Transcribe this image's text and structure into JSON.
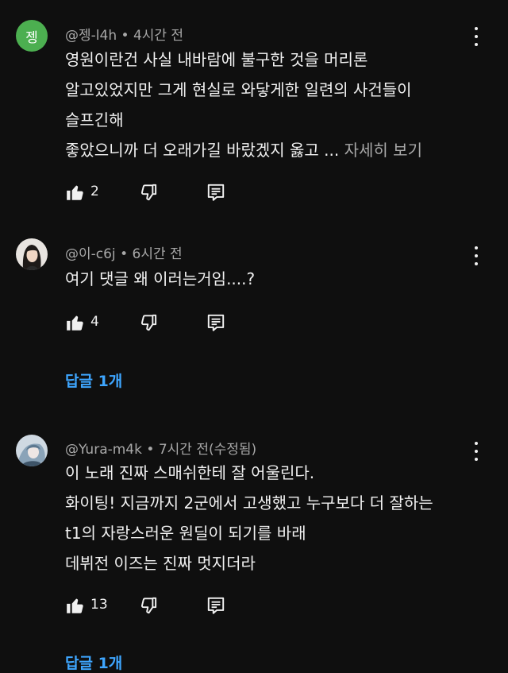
{
  "comments": [
    {
      "avatar_letter": "젱",
      "avatar_color": "#4caf50",
      "handle": "@젱-l4h",
      "time": "4시간 전",
      "lines": [
        "영원이란건 사실 내바람에 불구한 것을 머리론",
        "알고있었지만 그게 현실로 와닿게한 일련의 사건들이",
        "슬프긴해",
        " 좋았으니까 더 오래가길 바랐겠지 옳고 ..."
      ],
      "more_label": "자세히 보기",
      "likes": "2"
    },
    {
      "handle": "@이-c6j",
      "time": "6시간 전",
      "lines": [
        "여기 댓글 왜 이러는거임....?"
      ],
      "likes": "4",
      "replies_label": "답글 1개"
    },
    {
      "handle": "@Yura-m4k",
      "time": "7시간 전(수정됨)",
      "lines": [
        "이 노래 진짜 스매쉬한테 잘 어울린다.",
        "화이팅! 지금까지 2군에서 고생했고 누구보다 더 잘하는",
        "t1의 자랑스러운 원딜이 되기를 바래",
        "데뷔전 이즈는 진짜 멋지더라"
      ],
      "likes": "13",
      "replies_label": "답글 1개"
    }
  ],
  "separator": " • ",
  "colors": {
    "background": "#0f0f0f",
    "text": "#f1f1f1",
    "meta": "#a8a8a8",
    "link": "#3ea6ff"
  }
}
